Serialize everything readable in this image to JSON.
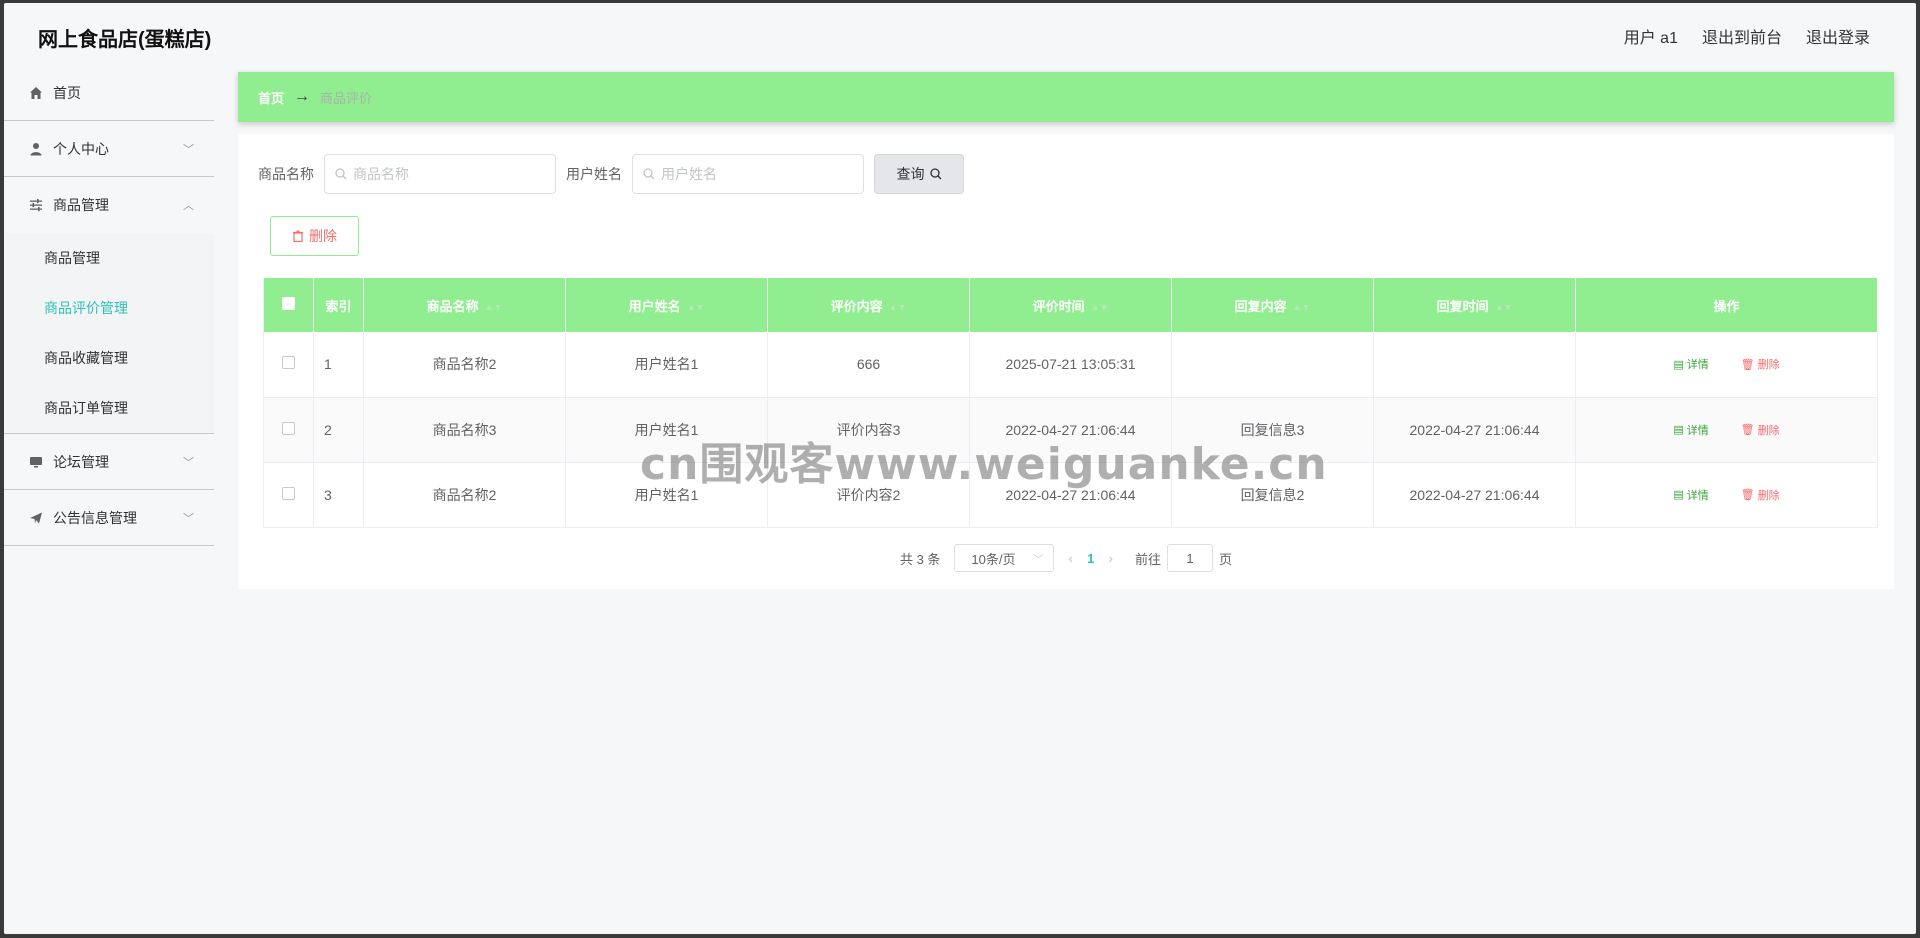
{
  "header": {
    "title": "网上食品店(蛋糕店)",
    "user": "用户 a1",
    "to_front": "退出到前台",
    "logout": "退出登录"
  },
  "sidebar": {
    "home": "首页",
    "personal": "个人中心",
    "goods_mgmt": "商品管理",
    "sub": [
      "商品管理",
      "商品评价管理",
      "商品收藏管理",
      "商品订单管理"
    ],
    "forum": "论坛管理",
    "notice": "公告信息管理"
  },
  "breadcrumb": {
    "home": "首页",
    "sep": "→",
    "current": "商品评价"
  },
  "search": {
    "goods_label": "商品名称",
    "goods_placeholder": "商品名称",
    "user_label": "用户姓名",
    "user_placeholder": "用户姓名",
    "query_label": "查询"
  },
  "toolbar": {
    "delete_label": "删除"
  },
  "table": {
    "headers": [
      "索引",
      "商品名称",
      "用户姓名",
      "评价内容",
      "评价时间",
      "回复内容",
      "回复时间",
      "操作"
    ],
    "rows": [
      [
        "1",
        "商品名称2",
        "用户姓名1",
        "666",
        "2025-07-21 13:05:31",
        "",
        ""
      ],
      [
        "2",
        "商品名称3",
        "用户姓名1",
        "评价内容3",
        "2022-04-27 21:06:44",
        "回复信息3",
        "2022-04-27 21:06:44"
      ],
      [
        "3",
        "商品名称2",
        "用户姓名1",
        "评价内容2",
        "2022-04-27 21:06:44",
        "回复信息2",
        "2022-04-27 21:06:44"
      ]
    ],
    "detail_label": "详情",
    "delete_label": "删除"
  },
  "pagination": {
    "total": "共 3 条",
    "page_size": "10条/页",
    "current": "1",
    "goto_prefix": "前往",
    "goto_value": "1",
    "goto_suffix": "页"
  },
  "watermark": "cn围观客www.weiguanke.cn",
  "colors": {
    "accent_green": "#90ee90",
    "active_teal": "#2ec1b6",
    "danger": "#f56c6c"
  }
}
